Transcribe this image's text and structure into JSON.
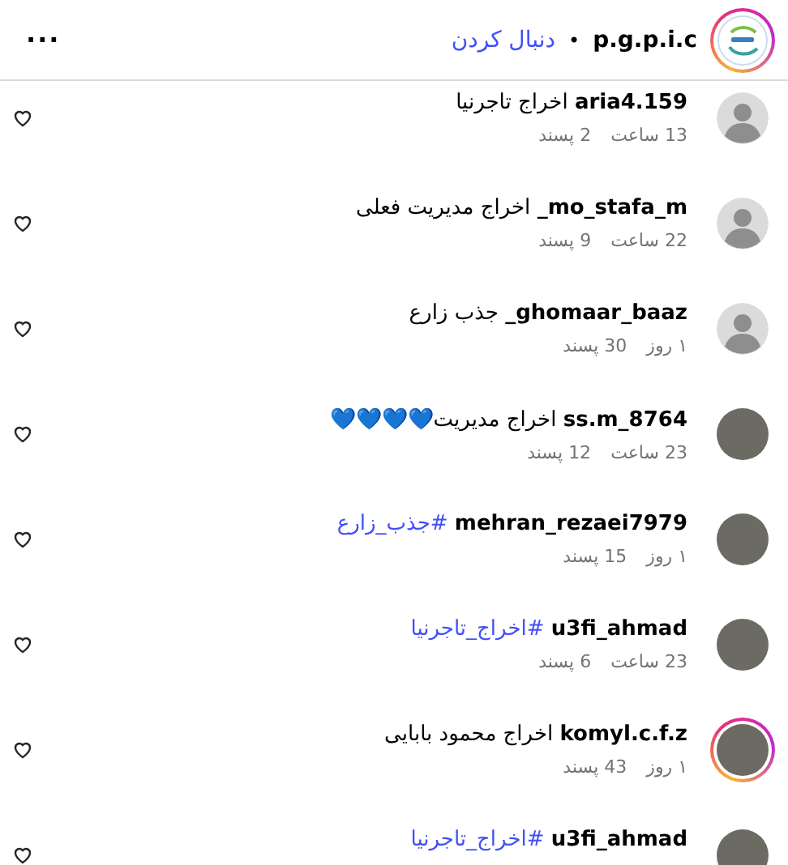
{
  "header": {
    "account": "p.g.p.i.c",
    "separator": "•",
    "follow": "دنبال کردن",
    "story_ring": true,
    "more": "···"
  },
  "comments": [
    {
      "photo": false,
      "story_ring": false,
      "username": "aria4.159",
      "text": "اخراج تاجرنیا",
      "hashtag": false,
      "time": "13 ساعت",
      "likes": "2 پسند"
    },
    {
      "photo": false,
      "story_ring": false,
      "username": "mo_stafa_m_",
      "text": "اخراج مدیریت فعلی",
      "hashtag": false,
      "time": "22 ساعت",
      "likes": "9 پسند"
    },
    {
      "photo": false,
      "story_ring": false,
      "username": "ghomaar_baaz_",
      "text": "جذب زارع",
      "hashtag": false,
      "time": "۱ روز",
      "likes": "30 پسند"
    },
    {
      "photo": true,
      "story_ring": false,
      "username": "ss.m_8764",
      "text": "اخراج مدیریت💙💙💙💙",
      "hashtag": false,
      "time": "23 ساعت",
      "likes": "12 پسند"
    },
    {
      "photo": true,
      "story_ring": false,
      "username": "mehran_rezaei7979",
      "text": "#جذب_زارع",
      "hashtag": true,
      "time": "۱ روز",
      "likes": "15 پسند"
    },
    {
      "photo": true,
      "story_ring": false,
      "username": "u3fi_ahmad",
      "text": "#اخراج_تاجرنیا",
      "hashtag": true,
      "time": "23 ساعت",
      "likes": "6 پسند"
    },
    {
      "photo": true,
      "story_ring": true,
      "username": "komyl.c.f.z",
      "text": "اخراج محمود بابایی",
      "hashtag": false,
      "time": "۱ روز",
      "likes": "43 پسند"
    },
    {
      "photo": true,
      "story_ring": false,
      "username": "u3fi_ahmad",
      "text": "#اخراج_تاجرنیا",
      "hashtag": true
    }
  ]
}
